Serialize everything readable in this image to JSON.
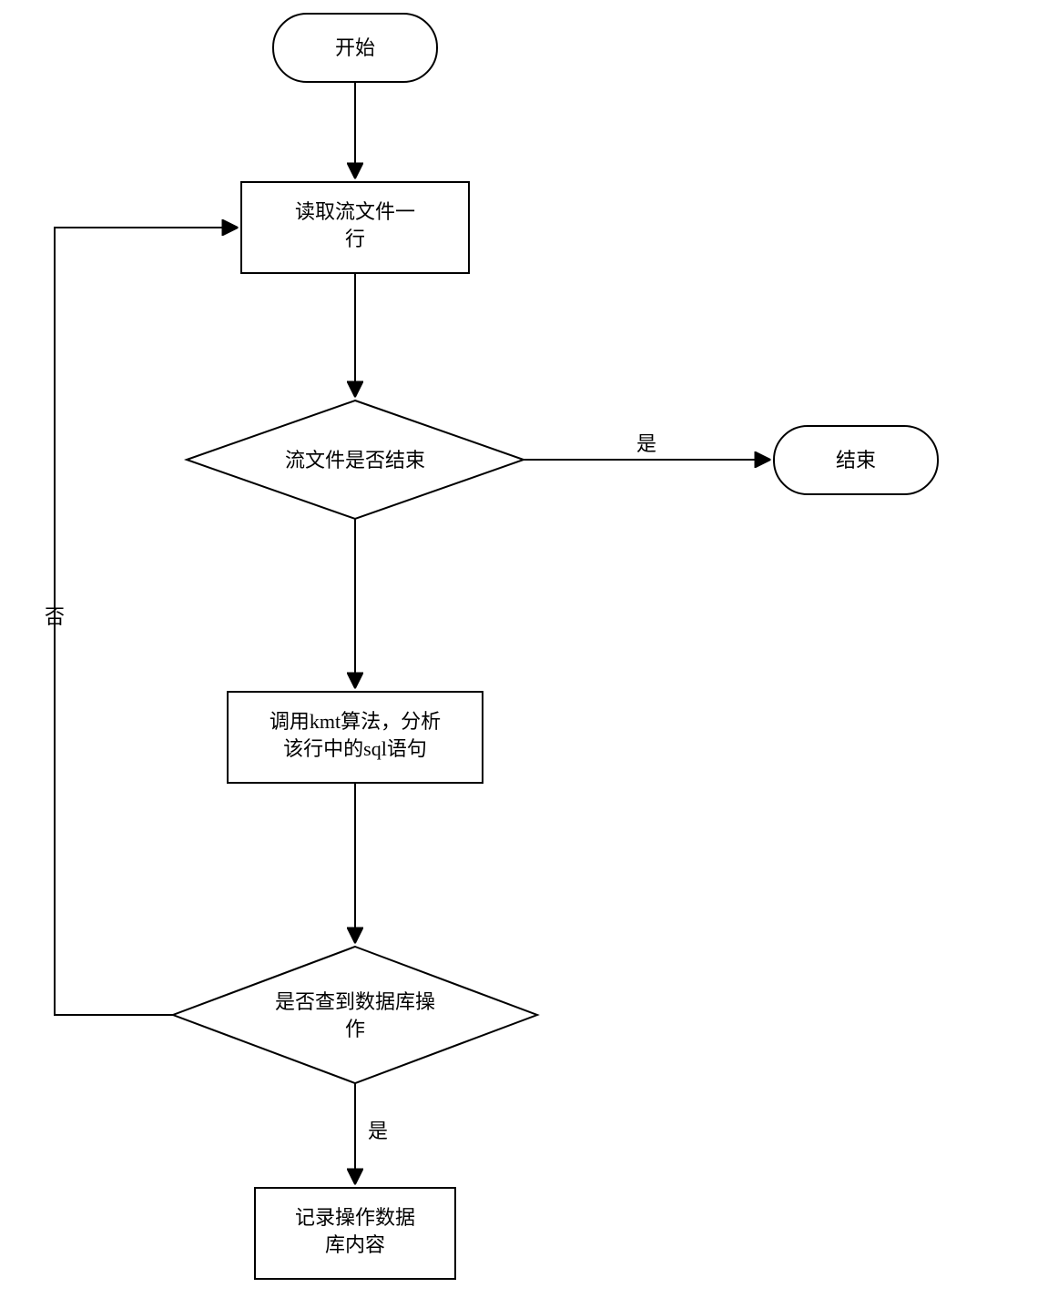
{
  "chart_data": {
    "type": "flowchart",
    "nodes": [
      {
        "id": "start",
        "kind": "terminator",
        "label": "开始"
      },
      {
        "id": "read",
        "kind": "process",
        "label": "读取流文件一行"
      },
      {
        "id": "eof",
        "kind": "decision",
        "label": "流文件是否结束"
      },
      {
        "id": "end",
        "kind": "terminator",
        "label": "结束"
      },
      {
        "id": "kmt",
        "kind": "process",
        "label": "调用kmt算法，分析该行中的sql语句"
      },
      {
        "id": "isdb",
        "kind": "decision",
        "label": "是否查到数据库操作"
      },
      {
        "id": "record",
        "kind": "process",
        "label": "记录操作数据库内容"
      }
    ],
    "edges": [
      {
        "from": "start",
        "to": "read",
        "label": ""
      },
      {
        "from": "read",
        "to": "eof",
        "label": ""
      },
      {
        "from": "eof",
        "to": "end",
        "label": "是"
      },
      {
        "from": "eof",
        "to": "kmt",
        "label": ""
      },
      {
        "from": "kmt",
        "to": "isdb",
        "label": ""
      },
      {
        "from": "isdb",
        "to": "record",
        "label": "是"
      },
      {
        "from": "isdb",
        "to": "read",
        "label": "否",
        "note": "loop back via left side"
      }
    ]
  },
  "labels": {
    "start": "开始",
    "read_l1": "读取流文件一",
    "read_l2": "行",
    "eof": "流文件是否结束",
    "end": "结束",
    "kmt_l1": "调用kmt算法，分析",
    "kmt_l2": "该行中的sql语句",
    "isdb_l1": "是否查到数据库操",
    "isdb_l2": "作",
    "record_l1": "记录操作数据",
    "record_l2": "库内容",
    "yes": "是",
    "no": "否"
  }
}
